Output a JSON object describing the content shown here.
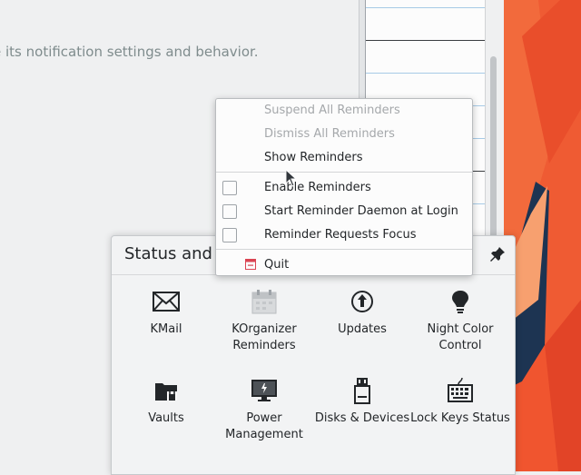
{
  "background_window": {
    "description_fragment": "e its notification settings and behavior."
  },
  "tray": {
    "title": "Status and",
    "items": [
      {
        "label": "KMail",
        "icon": "mail-envelope-icon"
      },
      {
        "label": "KOrganizer Reminders",
        "icon": "calendar-reminders-icon"
      },
      {
        "label": "Updates",
        "icon": "updates-icon"
      },
      {
        "label": "Night Color Control",
        "icon": "lightbulb-icon"
      },
      {
        "label": "Vaults",
        "icon": "vault-folder-lock-icon"
      },
      {
        "label": "Power Management",
        "icon": "monitor-power-icon"
      },
      {
        "label": "Disks & Devices",
        "icon": "removable-drive-icon"
      },
      {
        "label": "Lock Keys Status",
        "icon": "keyboard-icon"
      }
    ]
  },
  "context_menu": {
    "items": [
      {
        "label": "Suspend All Reminders",
        "enabled": false,
        "checkable": false
      },
      {
        "label": "Dismiss All Reminders",
        "enabled": false,
        "checkable": false
      },
      {
        "label": "Show Reminders",
        "enabled": true,
        "checkable": false
      },
      {
        "label": "Enable Reminders",
        "enabled": true,
        "checkable": true,
        "checked": false
      },
      {
        "label": "Start Reminder Daemon at Login",
        "enabled": true,
        "checkable": true,
        "checked": false
      },
      {
        "label": "Reminder Requests Focus",
        "enabled": true,
        "checkable": true,
        "checked": false
      },
      {
        "label": "Quit",
        "enabled": true,
        "checkable": false,
        "icon": "quit-icon"
      }
    ]
  },
  "colors": {
    "accent": "#3daee9",
    "wallpaper_orange": "#ef5b33",
    "quit_icon": "#da4453"
  }
}
